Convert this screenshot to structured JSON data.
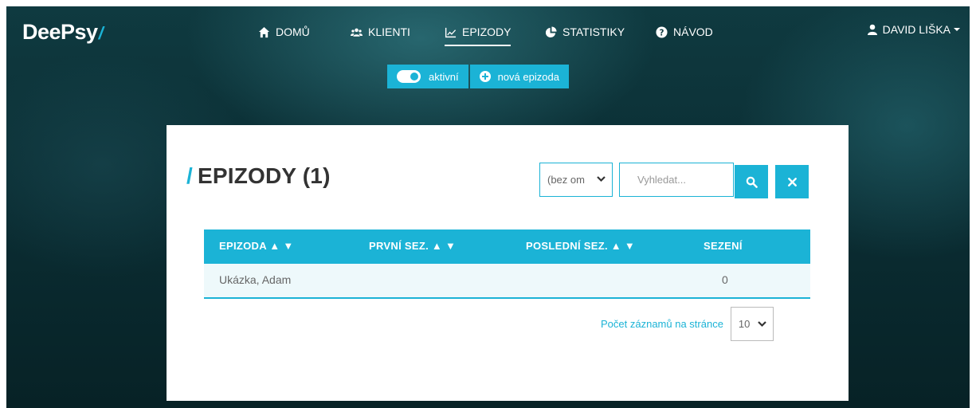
{
  "app": {
    "logo": "DeePsy",
    "logo_mark": "/"
  },
  "nav": {
    "items": [
      {
        "label": "DOMŮ",
        "icon": "home-icon"
      },
      {
        "label": "KLIENTI",
        "icon": "users-icon"
      },
      {
        "label": "EPIZODY",
        "icon": "chart-line-icon",
        "active": true
      },
      {
        "label": "STATISTIKY",
        "icon": "pie-chart-icon"
      },
      {
        "label": "NÁVOD",
        "icon": "question-circle-icon"
      }
    ],
    "user": "DAVID LIŠKA"
  },
  "toolbar": {
    "active_toggle_label": "aktivní",
    "new_episode_label": "nová epizoda"
  },
  "page": {
    "title_mark": "/",
    "title": "EPIZODY (1)"
  },
  "filters": {
    "select_value": "(bez om",
    "search_placeholder": "Vyhledat..."
  },
  "table": {
    "columns": [
      "EPIZODA ▲ ▼",
      "PRVNÍ SEZ. ▲ ▼",
      "POSLEDNÍ SEZ. ▲ ▼",
      "SEZENÍ"
    ],
    "rows": [
      {
        "episode": "Ukázka, Adam",
        "first": "",
        "last": "",
        "sessions": "0"
      }
    ]
  },
  "pager": {
    "label": "Počet záznamů na stránce",
    "value": "10"
  },
  "colors": {
    "accent": "#1bb3d6",
    "text": "#333333",
    "background": "#0b2e34"
  }
}
